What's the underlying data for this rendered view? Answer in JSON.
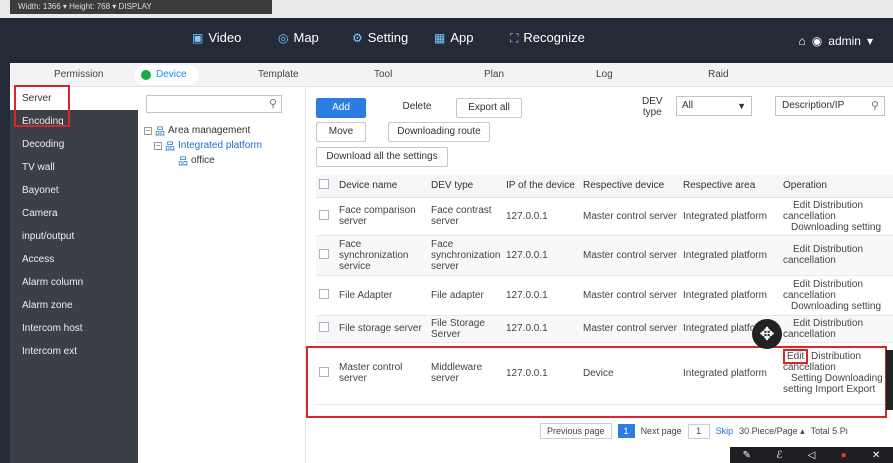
{
  "stub_bar": {
    "text": "Width:  1366 ▾   Height:  768 ▾   DISPLAY"
  },
  "topnav": {
    "items": [
      {
        "icon": "video-icon",
        "label": "Video"
      },
      {
        "icon": "map-icon",
        "label": "Map"
      },
      {
        "icon": "gear-icon",
        "label": "Setting"
      },
      {
        "icon": "app-icon",
        "label": "App"
      },
      {
        "icon": "recognize-icon",
        "label": "Recognize"
      }
    ],
    "user": "admin"
  },
  "subnav": {
    "items": [
      "Permission",
      "Device",
      "Template",
      "Tool",
      "Plan",
      "Log",
      "Raid"
    ],
    "active": "Device"
  },
  "sidebar": {
    "items": [
      "Server",
      "Encoding",
      "Decoding",
      "TV wall",
      "Bayonet",
      "Camera",
      "input/output",
      "Access",
      "Alarm column",
      "Alarm zone",
      "Intercom host",
      "Intercom ext"
    ],
    "active": "Server"
  },
  "tree": {
    "search_placeholder": "",
    "nodes": [
      "Area management",
      "Integrated platform",
      "office"
    ]
  },
  "toolbar": {
    "add": "Add",
    "delete": "Delete",
    "export_all": "Export all",
    "move": "Move",
    "downloading_route": "Downloading route",
    "download_all": "Download all the settings",
    "dev_type_label_1": "DEV",
    "dev_type_label_2": "type",
    "dev_type_value": "All",
    "desc_placeholder": "Description/IP"
  },
  "table": {
    "headers": [
      "Device name",
      "DEV type",
      "IP of the device",
      "Respective device",
      "Respective area",
      "Operation"
    ],
    "rows": [
      {
        "name": "Face comparison server",
        "type": "Face contrast server",
        "ip": "127.0.0.1",
        "device": "Master control server",
        "area": "Integrated platform",
        "op1": "Edit  Distribution",
        "op2": "cancellation",
        "op3": "Downloading setting"
      },
      {
        "name": "Face synchronization service",
        "type": "Face synchronization server",
        "ip": "127.0.0.1",
        "device": "Master control server",
        "area": "Integrated platform",
        "op1": "Edit  Distribution",
        "op2": "cancellation",
        "op3": ""
      },
      {
        "name": "File Adapter",
        "type": "File adapter",
        "ip": "127.0.0.1",
        "device": "Master control server",
        "area": "Integrated platform",
        "op1": "Edit  Distribution",
        "op2": "cancellation",
        "op3": "Downloading setting"
      },
      {
        "name": "File storage server",
        "type": "File Storage Server",
        "ip": "127.0.0.1",
        "device": "Master control server",
        "area": "Integrated platform",
        "op1": "Edit  Distribution",
        "op2": "cancellation",
        "op3": ""
      },
      {
        "name": "Master control server",
        "type": "Middleware server",
        "ip": "127.0.0.1",
        "device": "Device",
        "area": "Integrated platform",
        "op_edit": "Edit",
        "op1": "Distribution",
        "op2": "cancellation",
        "op3": "Setting  Downloading",
        "op4": "setting  Import  Export"
      }
    ]
  },
  "pagination": {
    "prev": "Previous page",
    "current": "1",
    "next": "Next page",
    "input": "1",
    "skip": "Skip",
    "per_page": "30 Piece/Page ▴",
    "total": "Total 5 Pi"
  },
  "colors": {
    "accent": "#2a7de1",
    "highlight": "#d9252c",
    "sidebar": "#3a3f48",
    "frame": "#252b36"
  }
}
